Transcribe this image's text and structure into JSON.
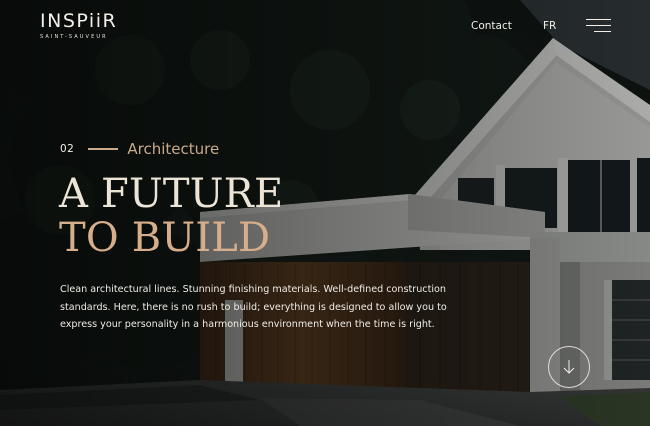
{
  "brand": {
    "name": "INSPiiR",
    "subtitle": "SAINT-SAUVEUR"
  },
  "nav": {
    "contact_label": "Contact",
    "language_label": "FR",
    "menu_icon": "hamburger-menu-icon"
  },
  "hero": {
    "section_number": "02",
    "section_label": "Architecture",
    "title_line1": "A FUTURE",
    "title_line2": "TO BUILD",
    "description": "Clean architectural lines. Stunning finishing materials. Well-defined construction standards. Here, there is no rush to build; everything is designed to allow you to express your personality in a harmonious environment when the time is right.",
    "scroll_icon": "arrow-down-icon"
  },
  "colors": {
    "accent": "#c9a98a",
    "title_light": "#ece4d6",
    "title_accent": "#d6ae8b",
    "text": "#efece6"
  }
}
